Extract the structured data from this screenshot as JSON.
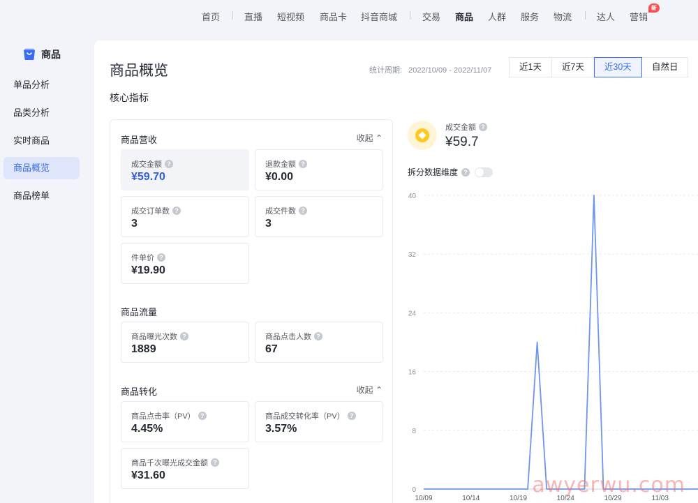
{
  "nav": {
    "items": [
      {
        "label": "首页",
        "active": false
      },
      {
        "label": "直播",
        "active": false
      },
      {
        "label": "短视频",
        "active": false
      },
      {
        "label": "商品卡",
        "active": false
      },
      {
        "label": "抖音商城",
        "active": false
      },
      {
        "label": "交易",
        "active": false
      },
      {
        "label": "商品",
        "active": true
      },
      {
        "label": "人群",
        "active": false
      },
      {
        "label": "服务",
        "active": false
      },
      {
        "label": "物流",
        "active": false
      },
      {
        "label": "达人",
        "active": false
      },
      {
        "label": "营销",
        "active": false
      }
    ],
    "badge": "新"
  },
  "sidebar": {
    "header": "商品",
    "header_icon": "shopping-bag-icon",
    "items": [
      {
        "label": "单品分析",
        "active": false
      },
      {
        "label": "品类分析",
        "active": false
      },
      {
        "label": "实时商品",
        "active": false
      },
      {
        "label": "商品概览",
        "active": true
      },
      {
        "label": "商品榜单",
        "active": false
      }
    ]
  },
  "main": {
    "title": "商品概览",
    "period_label": "统计周期:",
    "period_value": "2022/10/09 - 2022/11/07",
    "ranges": [
      {
        "label": "近1天",
        "active": false
      },
      {
        "label": "近7天",
        "active": false
      },
      {
        "label": "近30天",
        "active": true
      },
      {
        "label": "自然日",
        "active": false
      }
    ],
    "subtitle": "核心指标"
  },
  "metrics": {
    "revenue": {
      "title": "商品营收",
      "collapse": "收起",
      "items": [
        {
          "label": "成交金额",
          "value": "¥59.70",
          "active": true
        },
        {
          "label": "退款金额",
          "value": "¥0.00",
          "active": false
        },
        {
          "label": "成交订单数",
          "value": "3",
          "active": false
        },
        {
          "label": "成交件数",
          "value": "3",
          "active": false
        },
        {
          "label": "件单价",
          "value": "¥19.90",
          "active": false
        }
      ]
    },
    "traffic": {
      "title": "商品流量",
      "items": [
        {
          "label": "商品曝光次数",
          "value": "1889"
        },
        {
          "label": "商品点击人数",
          "value": "67"
        }
      ]
    },
    "conversion": {
      "title": "商品转化",
      "collapse": "收起",
      "items": [
        {
          "label": "商品点击率（PV）",
          "value": "4.45%"
        },
        {
          "label": "商品成交转化率（PV）",
          "value": "3.57%"
        },
        {
          "label": "商品千次曝光成交金额",
          "value": "¥31.60"
        }
      ]
    }
  },
  "kpi": {
    "label": "成交金额",
    "value": "¥59.7",
    "split_label": "拆分数据维度"
  },
  "chart_data": {
    "type": "line",
    "x": [
      "10/09",
      "10/10",
      "10/11",
      "10/12",
      "10/13",
      "10/14",
      "10/15",
      "10/16",
      "10/17",
      "10/18",
      "10/19",
      "10/20",
      "10/21",
      "10/22",
      "10/23",
      "10/24",
      "10/25",
      "10/26",
      "10/27",
      "10/28",
      "10/29",
      "10/30",
      "10/31",
      "11/01",
      "11/02",
      "11/03",
      "11/04",
      "11/05",
      "11/06",
      "11/07"
    ],
    "series": [
      {
        "values": [
          0,
          0,
          0,
          0,
          0,
          0,
          0,
          0,
          0,
          0,
          0,
          0,
          20,
          0,
          0,
          0,
          0,
          0,
          40,
          0,
          0,
          0,
          0,
          0,
          0,
          0,
          0,
          0,
          0,
          0
        ],
        "color": "#6b95ee"
      }
    ],
    "x_tick_labels": [
      "10/09",
      "10/14",
      "10/19",
      "10/24",
      "10/29",
      "11/03"
    ],
    "y_ticks": [
      0,
      8,
      16,
      24,
      32,
      40
    ],
    "ylim": [
      0,
      40
    ],
    "grid": true
  },
  "watermark": "awyerwu.com",
  "colors": {
    "accent": "#3a6cf4",
    "line": "#6b95ee",
    "coin": "#ffc81e"
  }
}
